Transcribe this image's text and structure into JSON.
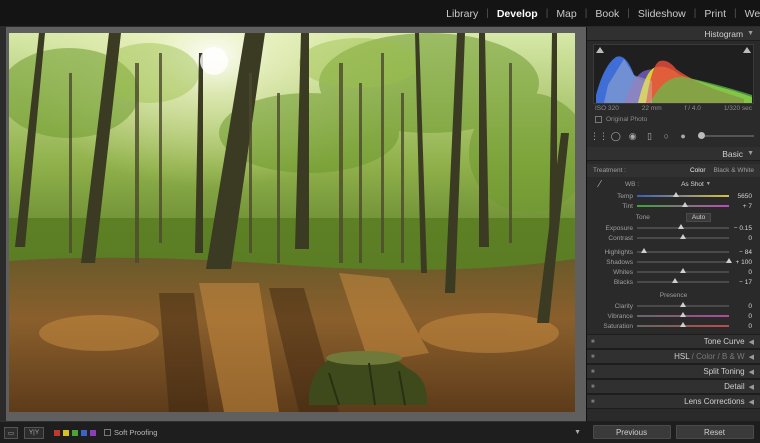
{
  "modules": [
    "Library",
    "Develop",
    "Map",
    "Book",
    "Slideshow",
    "Print",
    "Web"
  ],
  "active_module": "Develop",
  "panel": {
    "histogram_title": "Histogram",
    "exif": {
      "iso": "ISO 320",
      "focal": "22 mm",
      "aperture": "f / 4.0",
      "shutter": "1/320 sec"
    },
    "original_photo_label": "Original Photo",
    "basic_title": "Basic",
    "treatment_label": "Treatment :",
    "treatment_color": "Color",
    "treatment_bw": "Black & White",
    "wb_label": "WB :",
    "wb_value": "As Shot",
    "temp_label": "Temp",
    "temp_value": "5650",
    "tint_label": "Tint",
    "tint_value": "+ 7",
    "tone_label": "Tone",
    "auto_label": "Auto",
    "exposure_label": "Exposure",
    "exposure_value": "− 0.15",
    "contrast_label": "Contrast",
    "contrast_value": "0",
    "highlights_label": "Highlights",
    "highlights_value": "− 84",
    "shadows_label": "Shadows",
    "shadows_value": "+ 100",
    "whites_label": "Whites",
    "whites_value": "0",
    "blacks_label": "Blacks",
    "blacks_value": "− 17",
    "presence_label": "Presence",
    "clarity_label": "Clarity",
    "clarity_value": "0",
    "vibrance_label": "Vibrance",
    "vibrance_value": "0",
    "saturation_label": "Saturation",
    "saturation_value": "0",
    "tone_curve_title": "Tone Curve",
    "hsl_title": "HSL",
    "hsl_color": "Color",
    "hsl_bw": "B & W",
    "hsl_sep": "/",
    "split_toning_title": "Split Toning",
    "detail_title": "Detail",
    "lens_corrections_title": "Lens Corrections",
    "previous_label": "Previous",
    "reset_label": "Reset"
  },
  "slider_positions": {
    "temp": 0.42,
    "tint": 0.52,
    "exposure": 0.48,
    "contrast": 0.5,
    "highlights": 0.08,
    "shadows": 1.0,
    "whites": 0.5,
    "blacks": 0.41,
    "clarity": 0.5,
    "vibrance": 0.5,
    "saturation": 0.5
  },
  "toolbar": {
    "yy_label": "Y|Y",
    "soft_proofing_label": "Soft Proofing",
    "color_labels": [
      "#c0392b",
      "#d4c21f",
      "#4aa33a",
      "#3a63c7",
      "#8a3fb5"
    ]
  }
}
